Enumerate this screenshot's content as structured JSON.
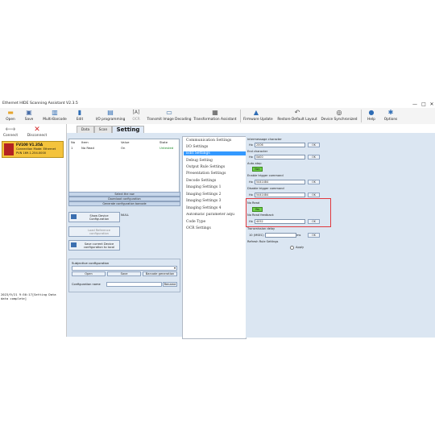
{
  "window": {
    "title": "Ethernet HIDE Scanning Assistant V2.3.5",
    "controls": [
      "—",
      "□",
      "✕"
    ]
  },
  "toolbar": {
    "buttons": [
      {
        "label": "Open",
        "icon": "folder-icon"
      },
      {
        "label": "Save",
        "icon": "save-icon"
      },
      {
        "label": "Multi-Barcode",
        "icon": "multi-barcode-icon"
      },
      {
        "label": "Edit",
        "icon": "edit-icon"
      },
      {
        "label": "I/O programming",
        "icon": "io-programming-icon"
      },
      {
        "label": "OCR",
        "icon": "ocr-icon"
      },
      {
        "label": "Transmit Image Decoding",
        "icon": "transmit-image-icon"
      },
      {
        "label": "Transformation Assistant",
        "icon": "transformation-icon"
      },
      {
        "label": "Firmware Update",
        "icon": "firmware-update-icon"
      },
      {
        "label": "Restore Default Layout",
        "icon": "restore-layout-icon"
      },
      {
        "label": "Device Synchronized",
        "icon": "device-sync-icon"
      },
      {
        "label": "Help",
        "icon": "help-icon"
      },
      {
        "label": "Options",
        "icon": "gear-icon"
      }
    ]
  },
  "device": {
    "connect_label": "Connect",
    "disconnect_label": "Disconnect",
    "card_lines": [
      "FV100 V1.35A",
      "Connection Mode: Ethernet",
      "PVN 169.1.254.0000"
    ]
  },
  "log": {
    "lines": [
      "2023/9/21 9:50:17[Setting Data",
      "data complete]"
    ]
  },
  "tabs": [
    {
      "label": "Data"
    },
    {
      "label": "Scan"
    },
    {
      "label": "Setting"
    }
  ],
  "table": {
    "headers": [
      "No",
      "Item",
      "Value",
      "State"
    ],
    "rows": [
      {
        "no": "1",
        "item": "No Read",
        "value": "On",
        "state": "Untested"
      }
    ]
  },
  "actions": {
    "select_row": "Select the row",
    "download_config": "Download configuration",
    "generate_config": "Generate configuration barcode",
    "show_device_config": "Show Device Configuration",
    "show_device_value": "NULL",
    "load_reference_config": "Load Reference configuration",
    "save_current_config": "Save current Device configuration to local"
  },
  "self_config": {
    "title": "Subjective configuration",
    "open": "Open",
    "save": "Save",
    "barcode_generation": "Barcode generation",
    "name_label": "Configuration name",
    "rename": "Rename"
  },
  "menu": {
    "items": [
      "Communication Settings",
      "I/O Settings",
      "Edit Settings",
      "Debug Setting",
      "Output Rule Settings",
      "Presentation Settings",
      "Decode Settings",
      "Imaging Settings 1",
      "Imaging Settings 2",
      "Imaging Settings 3",
      "Imaging Settings 4",
      "Automatic parameter adju",
      "Code Type",
      "OCR Settings"
    ],
    "selected_index": 2
  },
  "settings": {
    "intermessage_label": "Intermessage character",
    "intermessage_hex": "Hx",
    "intermessage_value": "2006",
    "intermessage_ok": "OK",
    "end_char_label": "End character",
    "end_char_hex": "Hx",
    "end_char_value": "0d00",
    "end_char_ok": "OK",
    "auto_stop_label": "Auto-stop",
    "auto_stop_value": "Non",
    "enable_trigger_label": "Enable trigger command",
    "enable_trigger_hex": "Hx",
    "enable_trigger_value": "5441484",
    "enable_trigger_ok": "OK",
    "disable_trigger_label": "Disable trigger command",
    "disable_trigger_hex": "Hx",
    "disable_trigger_value": "5441484",
    "disable_trigger_ok": "OK",
    "no_read_label": "No Read",
    "no_read_value": "Yes",
    "no_read_feedback_label": "No Read feedback",
    "no_read_feedback_hex": "Hx",
    "no_read_feedback_value": "4052",
    "no_read_feedback_ok": "OK",
    "transmission_delay_label": "Transmission delay",
    "transmission_delay_prefix": "10 (MSEC)",
    "transmission_delay_unit": "ms",
    "transmission_delay_ok": "OK",
    "refresh_rule_label": "Refresh Rule Settings",
    "apply_label": "Apply"
  },
  "colors": {
    "accent": "#3399ff",
    "highlight_border": "#e0393e",
    "toggle_green": "#6fd048",
    "device_card": "#f4c33c"
  }
}
